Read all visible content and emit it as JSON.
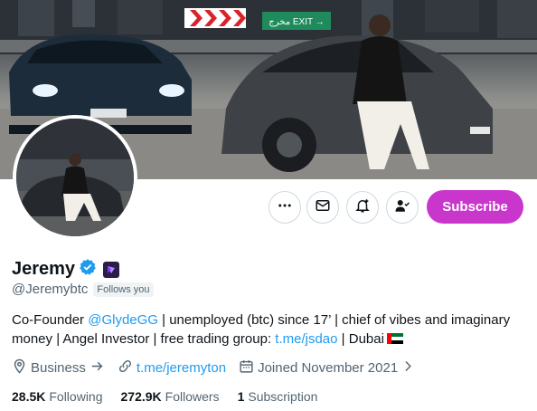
{
  "profile": {
    "name": "Jeremy",
    "handle": "@Jeremybtc",
    "follows_you": "Follows you",
    "bio_1": "Co-Founder ",
    "bio_mention": "@GlydeGG",
    "bio_2": " | unemployed (btc) since 17’ | chief of vibes and imaginary money | Angel Investor | free trading group: ",
    "bio_link": "t.me/jsdao",
    "bio_3": " | Dubai",
    "category": "Business",
    "website": "t.me/jeremyton",
    "joined": "Joined November 2021"
  },
  "stats": {
    "following_count": "28.5K",
    "following_label": "Following",
    "followers_count": "272.9K",
    "followers_label": "Followers",
    "subscriptions_count": "1",
    "subscriptions_label": "Subscription"
  },
  "actions": {
    "subscribe_label": "Subscribe"
  },
  "banner": {
    "exit_sign": "مخرج EXIT →"
  },
  "colors": {
    "subscribe": "#c936cc",
    "link": "#1d9bf0",
    "verified": "#1d9bf0",
    "muted": "#536471"
  }
}
